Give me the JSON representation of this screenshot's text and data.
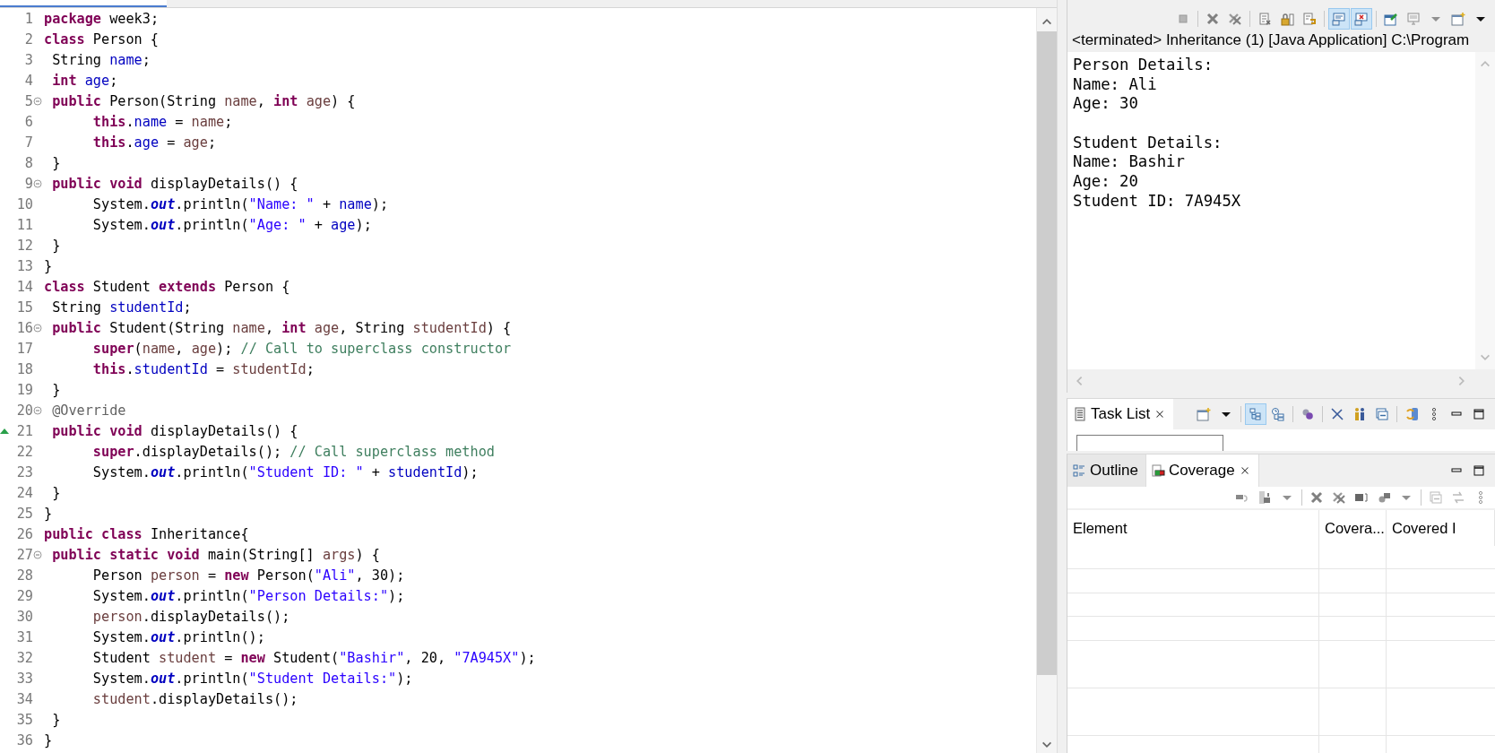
{
  "editor": {
    "lines": [
      {
        "number": "1",
        "fold": false,
        "override": false,
        "tokens": [
          {
            "kind": "kw",
            "text": "package"
          },
          {
            "kind": "plain",
            "text": " week3;"
          }
        ]
      },
      {
        "number": "2",
        "fold": false,
        "override": false,
        "tokens": [
          {
            "kind": "kw",
            "text": "class"
          },
          {
            "kind": "plain",
            "text": " Person {"
          }
        ]
      },
      {
        "number": "3",
        "fold": false,
        "override": false,
        "tokens": [
          {
            "kind": "plain",
            "text": " String "
          },
          {
            "kind": "field",
            "text": "name"
          },
          {
            "kind": "plain",
            "text": ";"
          }
        ]
      },
      {
        "number": "4",
        "fold": false,
        "override": false,
        "tokens": [
          {
            "kind": "kw",
            "text": " int "
          },
          {
            "kind": "field",
            "text": "age"
          },
          {
            "kind": "plain",
            "text": ";"
          }
        ]
      },
      {
        "number": "5",
        "fold": true,
        "override": false,
        "tokens": [
          {
            "kind": "kw",
            "text": " public"
          },
          {
            "kind": "plain",
            "text": " Person(String "
          },
          {
            "kind": "param",
            "text": "name"
          },
          {
            "kind": "plain",
            "text": ", "
          },
          {
            "kind": "kw",
            "text": "int "
          },
          {
            "kind": "param",
            "text": "age"
          },
          {
            "kind": "plain",
            "text": ") {"
          }
        ]
      },
      {
        "number": "6",
        "fold": false,
        "override": false,
        "tokens": [
          {
            "kind": "kw",
            "text": "      this"
          },
          {
            "kind": "plain",
            "text": "."
          },
          {
            "kind": "field",
            "text": "name"
          },
          {
            "kind": "plain",
            "text": " = "
          },
          {
            "kind": "param",
            "text": "name"
          },
          {
            "kind": "plain",
            "text": ";"
          }
        ]
      },
      {
        "number": "7",
        "fold": false,
        "override": false,
        "tokens": [
          {
            "kind": "kw",
            "text": "      this"
          },
          {
            "kind": "plain",
            "text": "."
          },
          {
            "kind": "field",
            "text": "age"
          },
          {
            "kind": "plain",
            "text": " = "
          },
          {
            "kind": "param",
            "text": "age"
          },
          {
            "kind": "plain",
            "text": ";"
          }
        ]
      },
      {
        "number": "8",
        "fold": false,
        "override": false,
        "tokens": [
          {
            "kind": "plain",
            "text": " }"
          }
        ]
      },
      {
        "number": "9",
        "fold": true,
        "override": false,
        "tokens": [
          {
            "kind": "kw",
            "text": " public void"
          },
          {
            "kind": "plain",
            "text": " displayDetails() {"
          }
        ]
      },
      {
        "number": "10",
        "fold": false,
        "override": false,
        "tokens": [
          {
            "kind": "plain",
            "text": "      System."
          },
          {
            "kind": "static",
            "text": "out"
          },
          {
            "kind": "plain",
            "text": ".println("
          },
          {
            "kind": "str",
            "text": "\"Name: \""
          },
          {
            "kind": "plain",
            "text": " + "
          },
          {
            "kind": "field",
            "text": "name"
          },
          {
            "kind": "plain",
            "text": ");"
          }
        ]
      },
      {
        "number": "11",
        "fold": false,
        "override": false,
        "tokens": [
          {
            "kind": "plain",
            "text": "      System."
          },
          {
            "kind": "static",
            "text": "out"
          },
          {
            "kind": "plain",
            "text": ".println("
          },
          {
            "kind": "str",
            "text": "\"Age: \""
          },
          {
            "kind": "plain",
            "text": " + "
          },
          {
            "kind": "field",
            "text": "age"
          },
          {
            "kind": "plain",
            "text": ");"
          }
        ]
      },
      {
        "number": "12",
        "fold": false,
        "override": false,
        "tokens": [
          {
            "kind": "plain",
            "text": " }"
          }
        ]
      },
      {
        "number": "13",
        "fold": false,
        "override": false,
        "tokens": [
          {
            "kind": "plain",
            "text": "}"
          }
        ]
      },
      {
        "number": "14",
        "fold": false,
        "override": false,
        "tokens": [
          {
            "kind": "kw",
            "text": "class"
          },
          {
            "kind": "plain",
            "text": " Student "
          },
          {
            "kind": "kw",
            "text": "extends"
          },
          {
            "kind": "plain",
            "text": " Person {"
          }
        ]
      },
      {
        "number": "15",
        "fold": false,
        "override": false,
        "tokens": [
          {
            "kind": "plain",
            "text": " String "
          },
          {
            "kind": "field",
            "text": "studentId"
          },
          {
            "kind": "plain",
            "text": ";"
          }
        ]
      },
      {
        "number": "16",
        "fold": true,
        "override": false,
        "tokens": [
          {
            "kind": "kw",
            "text": " public"
          },
          {
            "kind": "plain",
            "text": " Student(String "
          },
          {
            "kind": "param",
            "text": "name"
          },
          {
            "kind": "plain",
            "text": ", "
          },
          {
            "kind": "kw",
            "text": "int "
          },
          {
            "kind": "param",
            "text": "age"
          },
          {
            "kind": "plain",
            "text": ", String "
          },
          {
            "kind": "param",
            "text": "studentId"
          },
          {
            "kind": "plain",
            "text": ") {"
          }
        ]
      },
      {
        "number": "17",
        "fold": false,
        "override": false,
        "tokens": [
          {
            "kind": "kw",
            "text": "      super"
          },
          {
            "kind": "plain",
            "text": "("
          },
          {
            "kind": "param",
            "text": "name"
          },
          {
            "kind": "plain",
            "text": ", "
          },
          {
            "kind": "param",
            "text": "age"
          },
          {
            "kind": "plain",
            "text": "); "
          },
          {
            "kind": "com",
            "text": "// Call to superclass constructor"
          }
        ]
      },
      {
        "number": "18",
        "fold": false,
        "override": false,
        "tokens": [
          {
            "kind": "kw",
            "text": "      this"
          },
          {
            "kind": "plain",
            "text": "."
          },
          {
            "kind": "field",
            "text": "studentId"
          },
          {
            "kind": "plain",
            "text": " = "
          },
          {
            "kind": "param",
            "text": "studentId"
          },
          {
            "kind": "plain",
            "text": ";"
          }
        ]
      },
      {
        "number": "19",
        "fold": false,
        "override": false,
        "tokens": [
          {
            "kind": "plain",
            "text": " }"
          }
        ]
      },
      {
        "number": "20",
        "fold": true,
        "override": false,
        "tokens": [
          {
            "kind": "ann",
            "text": " @Override"
          }
        ]
      },
      {
        "number": "21",
        "fold": false,
        "override": true,
        "tokens": [
          {
            "kind": "kw",
            "text": " public void"
          },
          {
            "kind": "plain",
            "text": " displayDetails() {"
          }
        ]
      },
      {
        "number": "22",
        "fold": false,
        "override": false,
        "tokens": [
          {
            "kind": "kw",
            "text": "      super"
          },
          {
            "kind": "plain",
            "text": ".displayDetails(); "
          },
          {
            "kind": "com",
            "text": "// Call superclass method"
          }
        ]
      },
      {
        "number": "23",
        "fold": false,
        "override": false,
        "tokens": [
          {
            "kind": "plain",
            "text": "      System."
          },
          {
            "kind": "static",
            "text": "out"
          },
          {
            "kind": "plain",
            "text": ".println("
          },
          {
            "kind": "str",
            "text": "\"Student ID: \""
          },
          {
            "kind": "plain",
            "text": " + "
          },
          {
            "kind": "field",
            "text": "studentId"
          },
          {
            "kind": "plain",
            "text": ");"
          }
        ]
      },
      {
        "number": "24",
        "fold": false,
        "override": false,
        "tokens": [
          {
            "kind": "plain",
            "text": " }"
          }
        ]
      },
      {
        "number": "25",
        "fold": false,
        "override": false,
        "tokens": [
          {
            "kind": "plain",
            "text": "}"
          }
        ]
      },
      {
        "number": "26",
        "fold": false,
        "override": false,
        "tokens": [
          {
            "kind": "kw",
            "text": "public class"
          },
          {
            "kind": "plain",
            "text": " Inheritance{"
          }
        ]
      },
      {
        "number": "27",
        "fold": true,
        "override": false,
        "tokens": [
          {
            "kind": "kw",
            "text": " public static void"
          },
          {
            "kind": "plain",
            "text": " main(String[] "
          },
          {
            "kind": "param",
            "text": "args"
          },
          {
            "kind": "plain",
            "text": ") {"
          }
        ]
      },
      {
        "number": "28",
        "fold": false,
        "override": false,
        "tokens": [
          {
            "kind": "plain",
            "text": "      Person "
          },
          {
            "kind": "param",
            "text": "person"
          },
          {
            "kind": "plain",
            "text": " = "
          },
          {
            "kind": "kw",
            "text": "new"
          },
          {
            "kind": "plain",
            "text": " Person("
          },
          {
            "kind": "str",
            "text": "\"Ali\""
          },
          {
            "kind": "plain",
            "text": ", 30);"
          }
        ]
      },
      {
        "number": "29",
        "fold": false,
        "override": false,
        "tokens": [
          {
            "kind": "plain",
            "text": "      System."
          },
          {
            "kind": "static",
            "text": "out"
          },
          {
            "kind": "plain",
            "text": ".println("
          },
          {
            "kind": "str",
            "text": "\"Person Details:\""
          },
          {
            "kind": "plain",
            "text": ");"
          }
        ]
      },
      {
        "number": "30",
        "fold": false,
        "override": false,
        "tokens": [
          {
            "kind": "param",
            "text": "      person"
          },
          {
            "kind": "plain",
            "text": ".displayDetails();"
          }
        ]
      },
      {
        "number": "31",
        "fold": false,
        "override": false,
        "tokens": [
          {
            "kind": "plain",
            "text": "      System."
          },
          {
            "kind": "static",
            "text": "out"
          },
          {
            "kind": "plain",
            "text": ".println();"
          }
        ]
      },
      {
        "number": "32",
        "fold": false,
        "override": false,
        "tokens": [
          {
            "kind": "plain",
            "text": "      Student "
          },
          {
            "kind": "param",
            "text": "student"
          },
          {
            "kind": "plain",
            "text": " = "
          },
          {
            "kind": "kw",
            "text": "new"
          },
          {
            "kind": "plain",
            "text": " Student("
          },
          {
            "kind": "str",
            "text": "\"Bashir\""
          },
          {
            "kind": "plain",
            "text": ", 20, "
          },
          {
            "kind": "str",
            "text": "\"7A945X\""
          },
          {
            "kind": "plain",
            "text": ");"
          }
        ]
      },
      {
        "number": "33",
        "fold": false,
        "override": false,
        "tokens": [
          {
            "kind": "plain",
            "text": "      System."
          },
          {
            "kind": "static",
            "text": "out"
          },
          {
            "kind": "plain",
            "text": ".println("
          },
          {
            "kind": "str",
            "text": "\"Student Details:\""
          },
          {
            "kind": "plain",
            "text": ");"
          }
        ]
      },
      {
        "number": "34",
        "fold": false,
        "override": false,
        "tokens": [
          {
            "kind": "param",
            "text": "      student"
          },
          {
            "kind": "plain",
            "text": ".displayDetails();"
          }
        ]
      },
      {
        "number": "35",
        "fold": false,
        "override": false,
        "tokens": [
          {
            "kind": "plain",
            "text": " }"
          }
        ]
      },
      {
        "number": "36",
        "fold": false,
        "override": false,
        "tokens": [
          {
            "kind": "plain",
            "text": "}"
          }
        ]
      }
    ]
  },
  "console": {
    "toolbar": [
      {
        "kind": "stop",
        "pressed": false
      },
      {
        "kind": "remove",
        "pressed": false
      },
      {
        "kind": "remove-all",
        "pressed": false
      },
      {
        "kind": "clear",
        "pressed": false
      },
      {
        "kind": "lock",
        "pressed": false
      },
      {
        "kind": "wrap",
        "pressed": false
      },
      {
        "kind": "show-out",
        "pressed": true
      },
      {
        "kind": "show-err",
        "pressed": true
      },
      {
        "kind": "pin",
        "pressed": false
      },
      {
        "kind": "display",
        "pressed": false
      },
      {
        "kind": "dropdown",
        "pressed": false
      },
      {
        "kind": "new",
        "pressed": false
      },
      {
        "kind": "dropdown-dark",
        "pressed": false
      }
    ],
    "title": "<terminated> Inheritance (1) [Java Application] C:\\Program",
    "output": [
      {
        "lines": [
          "Person Details:",
          "Name: Ali",
          "Age: 30"
        ]
      },
      {
        "lines": [
          "Student Details:",
          "Name: Bashir",
          "Age: 20",
          "Student ID: 7A945X"
        ]
      }
    ]
  },
  "task_list": {
    "tab": {
      "label": "Task List",
      "selected": true
    },
    "toolbar": [
      {
        "kind": "new",
        "pressed": false
      },
      {
        "kind": "dropdown-dark",
        "pressed": false
      },
      {
        "kind": "category",
        "pressed": true
      },
      {
        "kind": "schedule",
        "pressed": false
      },
      {
        "kind": "sphere",
        "pressed": false
      },
      {
        "kind": "unlink",
        "pressed": false
      },
      {
        "kind": "people",
        "pressed": false
      },
      {
        "kind": "collapse",
        "pressed": false
      },
      {
        "kind": "sync",
        "pressed": false
      },
      {
        "kind": "more",
        "pressed": false
      }
    ]
  },
  "bottom_panel": {
    "tabs": [
      {
        "label": "Outline",
        "kind": "outline",
        "selected": false
      },
      {
        "label": "Coverage",
        "kind": "coverage",
        "selected": true
      }
    ],
    "table": {
      "columns": [
        "Element",
        "Covera...",
        "Covered I"
      ]
    }
  }
}
